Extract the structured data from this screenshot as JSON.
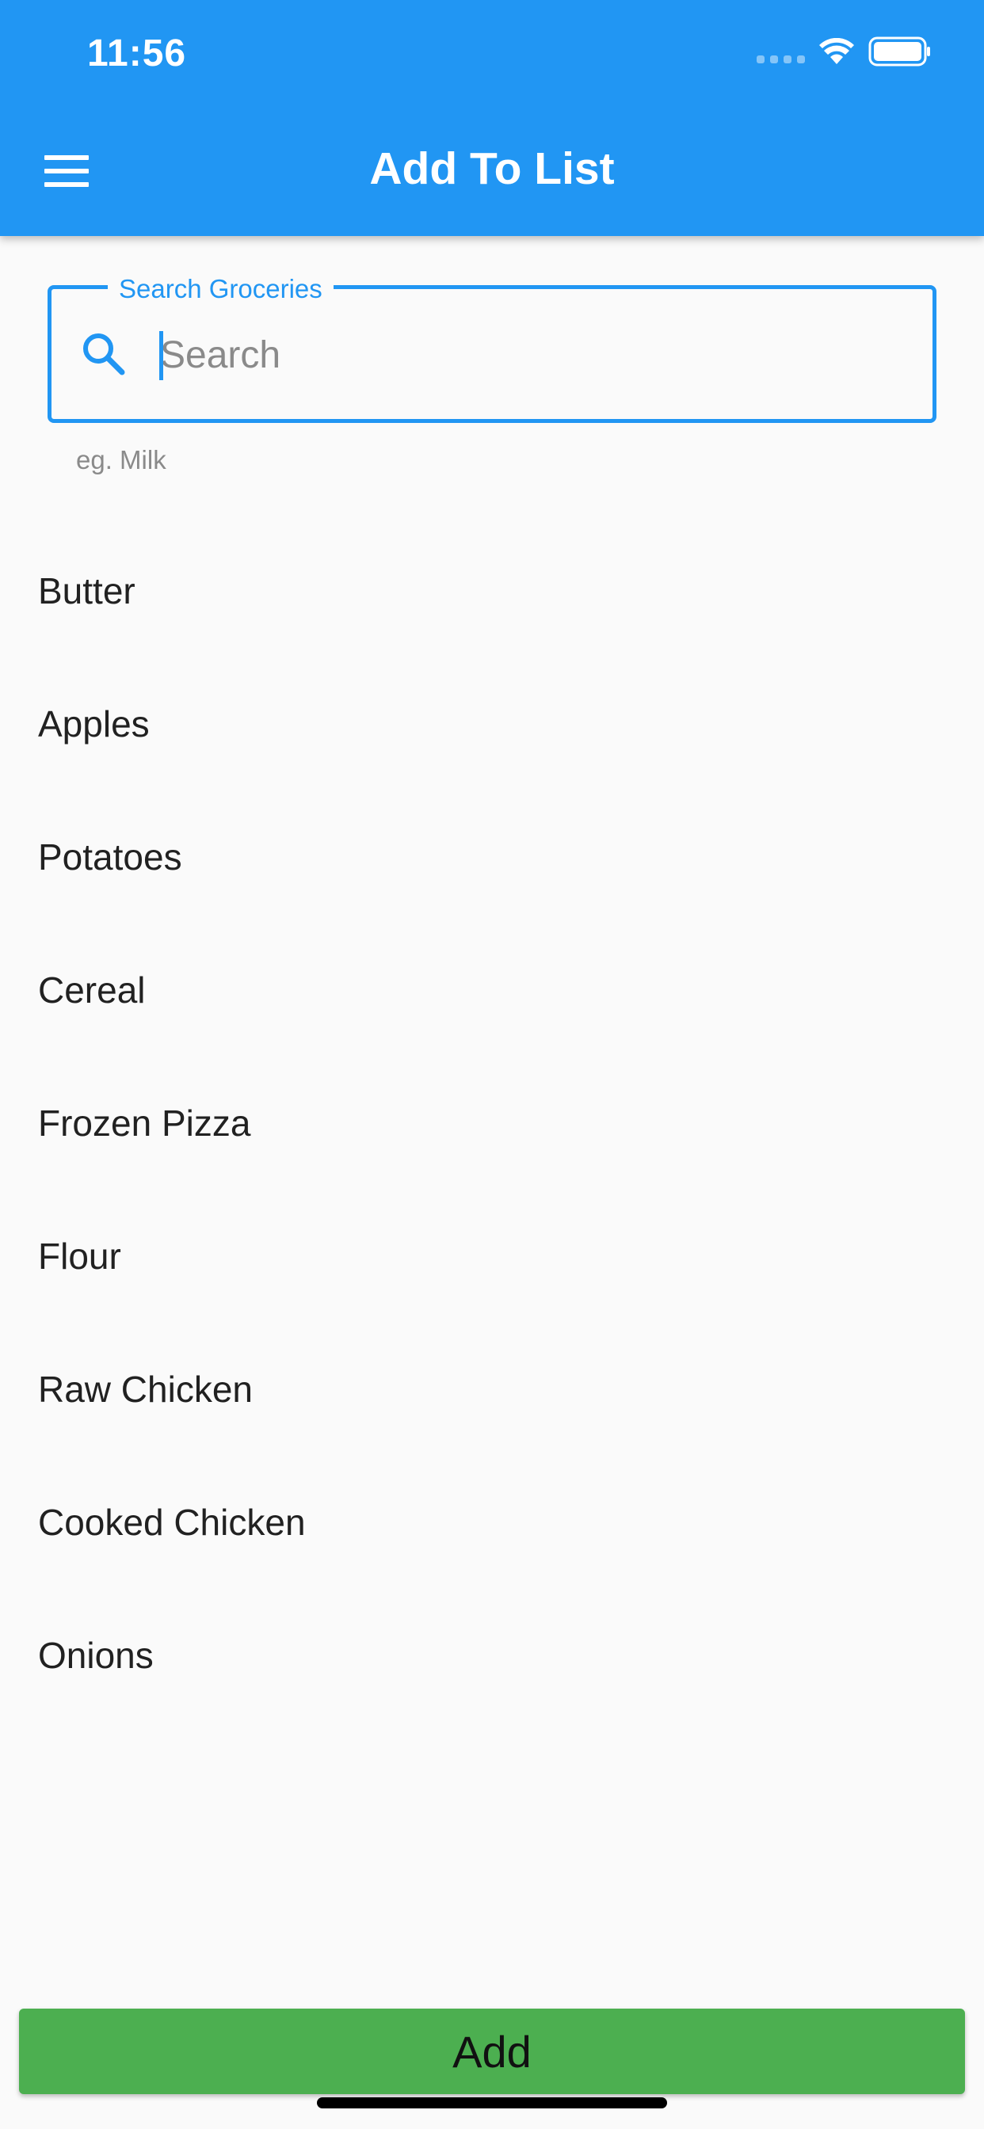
{
  "status_bar": {
    "time": "11:56",
    "icons": [
      "cellular-signal-icon",
      "wifi-icon",
      "battery-icon"
    ]
  },
  "app_bar": {
    "menu_icon": "hamburger-menu-icon",
    "title": "Add To List",
    "background_color": "#2196f3"
  },
  "search": {
    "label": "Search Groceries",
    "placeholder": "Search",
    "value": "",
    "helper": "eg. Milk",
    "icon": "search-icon",
    "accent_color": "#2196f3"
  },
  "groceries": [
    "Butter",
    "Apples",
    "Potatoes",
    "Cereal",
    "Frozen Pizza",
    "Flour",
    "Raw Chicken",
    "Cooked Chicken",
    "Onions"
  ],
  "add_button": {
    "label": "Add",
    "color": "#4caf50"
  }
}
